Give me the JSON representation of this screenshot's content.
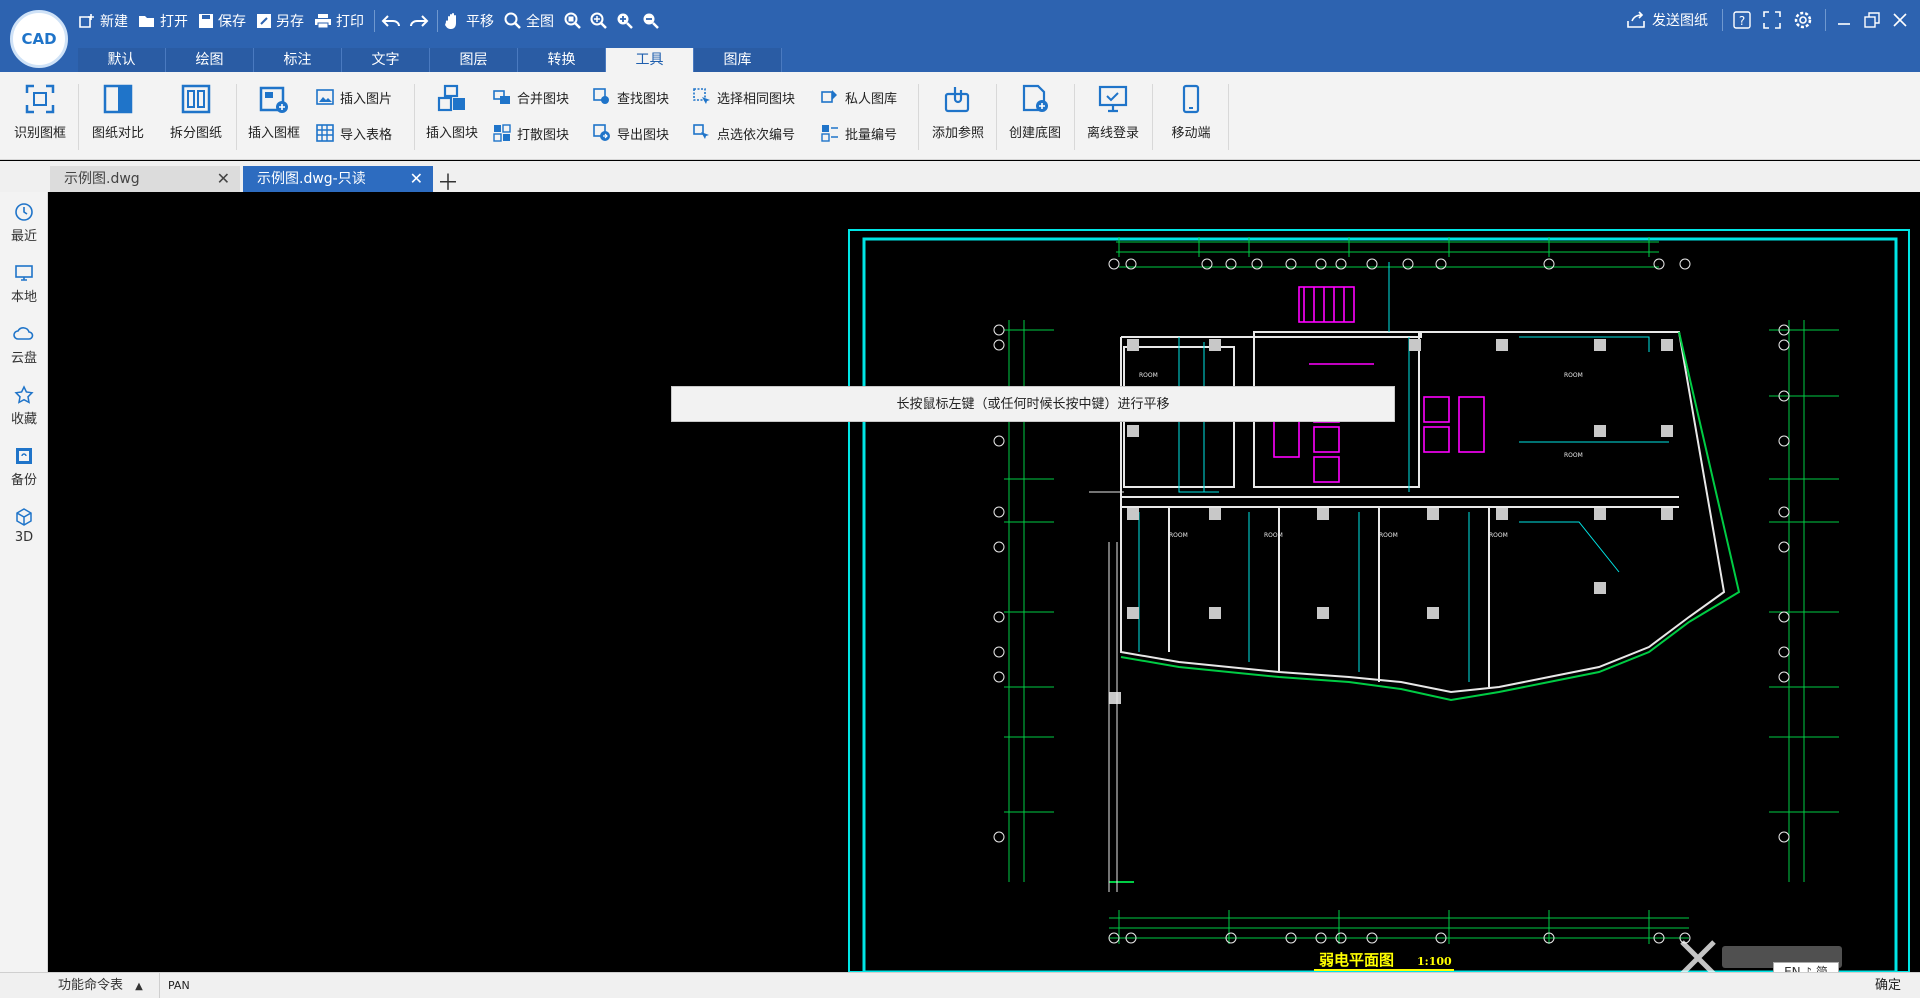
{
  "app": {
    "logo_text": "CAD"
  },
  "quick_toolbar": {
    "new": "新建",
    "open": "打开",
    "save": "保存",
    "save_as": "另存",
    "print": "打印",
    "pan": "平移",
    "full_view": "全图"
  },
  "top_right": {
    "send_drawing": "发送图纸"
  },
  "menu_tabs": [
    "默认",
    "绘图",
    "标注",
    "文字",
    "图层",
    "转换",
    "工具",
    "图库"
  ],
  "active_tab": "工具",
  "ribbon": {
    "recognize_frame": "识别图框",
    "compare_drawing": "图纸对比",
    "split_drawing": "拆分图纸",
    "insert_frame": "插入图框",
    "insert_image": "插入图片",
    "import_table": "导入表格",
    "insert_block": "插入图块",
    "merge_block": "合并图块",
    "explode_block": "打散图块",
    "find_block": "查找图块",
    "export_block": "导出图块",
    "select_same_block": "选择相同图块",
    "click_sequential_number": "点选依次编号",
    "private_library": "私人图库",
    "batch_number": "批量编号",
    "add_reference": "添加参照",
    "create_base_map": "创建底图",
    "offline_login": "离线登录",
    "mobile": "移动端"
  },
  "doc_tabs": [
    {
      "label": "示例图.dwg",
      "active": false
    },
    {
      "label": "示例图.dwg-只读",
      "active": true
    }
  ],
  "sidebar": [
    {
      "label": "最近",
      "icon": "clock-icon"
    },
    {
      "label": "本地",
      "icon": "monitor-icon"
    },
    {
      "label": "云盘",
      "icon": "cloud-icon"
    },
    {
      "label": "收藏",
      "icon": "star-icon"
    },
    {
      "label": "备份",
      "icon": "backup-icon"
    },
    {
      "label": "3D",
      "icon": "cube-icon"
    }
  ],
  "canvas": {
    "tooltip": "长按鼠标左键（或任何时候长按中键）进行平移",
    "drawing_title": "弱电平面图",
    "drawing_scale": "1:100",
    "colors": {
      "frame": "#00e5e5",
      "grid": "#00cc44",
      "wall": "#e8e8e8",
      "accent": "#ff00ff",
      "title": "#ffff00"
    }
  },
  "status_bar": {
    "command_table": "功能命令表",
    "command_text": "PAN",
    "confirm": "确定",
    "ime_text": "EN ♪ 简"
  }
}
